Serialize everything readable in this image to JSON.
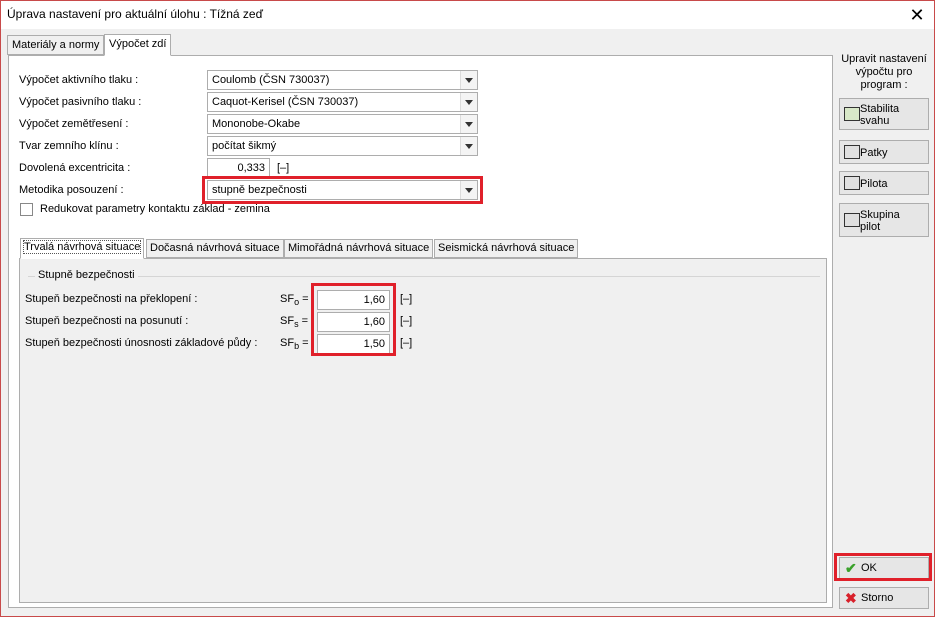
{
  "window": {
    "title": "Úprava nastavení pro aktuální úlohu : Tížná zeď"
  },
  "tabs": [
    "Materiály a normy",
    "Výpočet zdí"
  ],
  "form": {
    "rows": [
      {
        "label": "Výpočet aktivního tlaku :",
        "value": "Coulomb (ČSN 730037)"
      },
      {
        "label": "Výpočet pasivního tlaku :",
        "value": "Caquot-Kerisel (ČSN 730037)"
      },
      {
        "label": "Výpočet zemětřesení :",
        "value": "Mononobe-Okabe"
      },
      {
        "label": "Tvar zemního klínu :",
        "value": "počítat šikmý"
      }
    ],
    "eccentricity": {
      "label": "Dovolená excentricita :",
      "value": "0,333",
      "unit": "[–]"
    },
    "method": {
      "label": "Metodika posouzení :",
      "value": "stupně bezpečnosti"
    },
    "reduce_checkbox": {
      "label": "Redukovat parametry kontaktu základ - zemina",
      "checked": false
    }
  },
  "situation_tabs": [
    "Trvalá návrhová situace",
    "Dočasná návrhová situace",
    "Mimořádná návrhová situace",
    "Seismická návrhová situace"
  ],
  "safety": {
    "group_title": "Stupně bezpečnosti",
    "rows": [
      {
        "label": "Stupeň bezpečnosti na překlopení :",
        "sym": "SF",
        "sub": "o",
        "eq": " =",
        "value": "1,60",
        "unit": "[–]"
      },
      {
        "label": "Stupeň bezpečnosti na posunutí :",
        "sym": "SF",
        "sub": "s",
        "eq": " =",
        "value": "1,60",
        "unit": "[–]"
      },
      {
        "label": "Stupeň bezpečnosti únosnosti základové půdy :",
        "sym": "SF",
        "sub": "b",
        "eq": " =",
        "value": "1,50",
        "unit": "[–]"
      }
    ]
  },
  "sidebar": {
    "text": "Upravit nastavení výpočtu pro program :",
    "buttons": [
      {
        "label": "Stabilita svahu",
        "icon": "slope-stability-icon"
      },
      {
        "label": "Patky",
        "icon": "footing-icon"
      },
      {
        "label": "Pilota",
        "icon": "pile-icon"
      },
      {
        "label": "Skupina pilot",
        "icon": "pile-group-icon"
      }
    ]
  },
  "actions": {
    "ok_label": "OK",
    "cancel_label": "Storno"
  },
  "colors": {
    "highlight": "#e0202a",
    "ok_check": "#3aa12a",
    "cancel_x": "#d8202a"
  }
}
